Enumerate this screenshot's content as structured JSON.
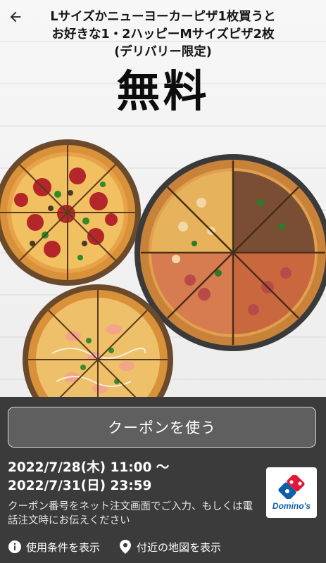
{
  "header": {
    "back_label": "back",
    "headline_line1": "Lサイズかニューヨーカーピザ1枚買うと",
    "headline_line2": "お好きな1・2ハッピーMサイズピザ2枚",
    "headline_line3": "(デリバリー限定)",
    "free_label": "無料"
  },
  "coupon": {
    "use_button_label": "クーポンを使う",
    "valid_from": "2022/7/28(木) 11:00 〜",
    "valid_to": "2022/7/31(日) 23:59",
    "note": "クーポン番号をネット注文画面でご入力、もしくは電話注文時にお伝えください",
    "brand_name": "Domino's"
  },
  "links": [
    {
      "label": "使用条件を表示",
      "icon": "info-icon"
    },
    {
      "label": "付近の地図を表示",
      "icon": "location-pin-icon"
    }
  ],
  "colors": {
    "panel_bg": "#3b3b3b",
    "button_bg": "#5f5f5f",
    "brand_blue": "#0b5ea8",
    "brand_red": "#e31837"
  }
}
